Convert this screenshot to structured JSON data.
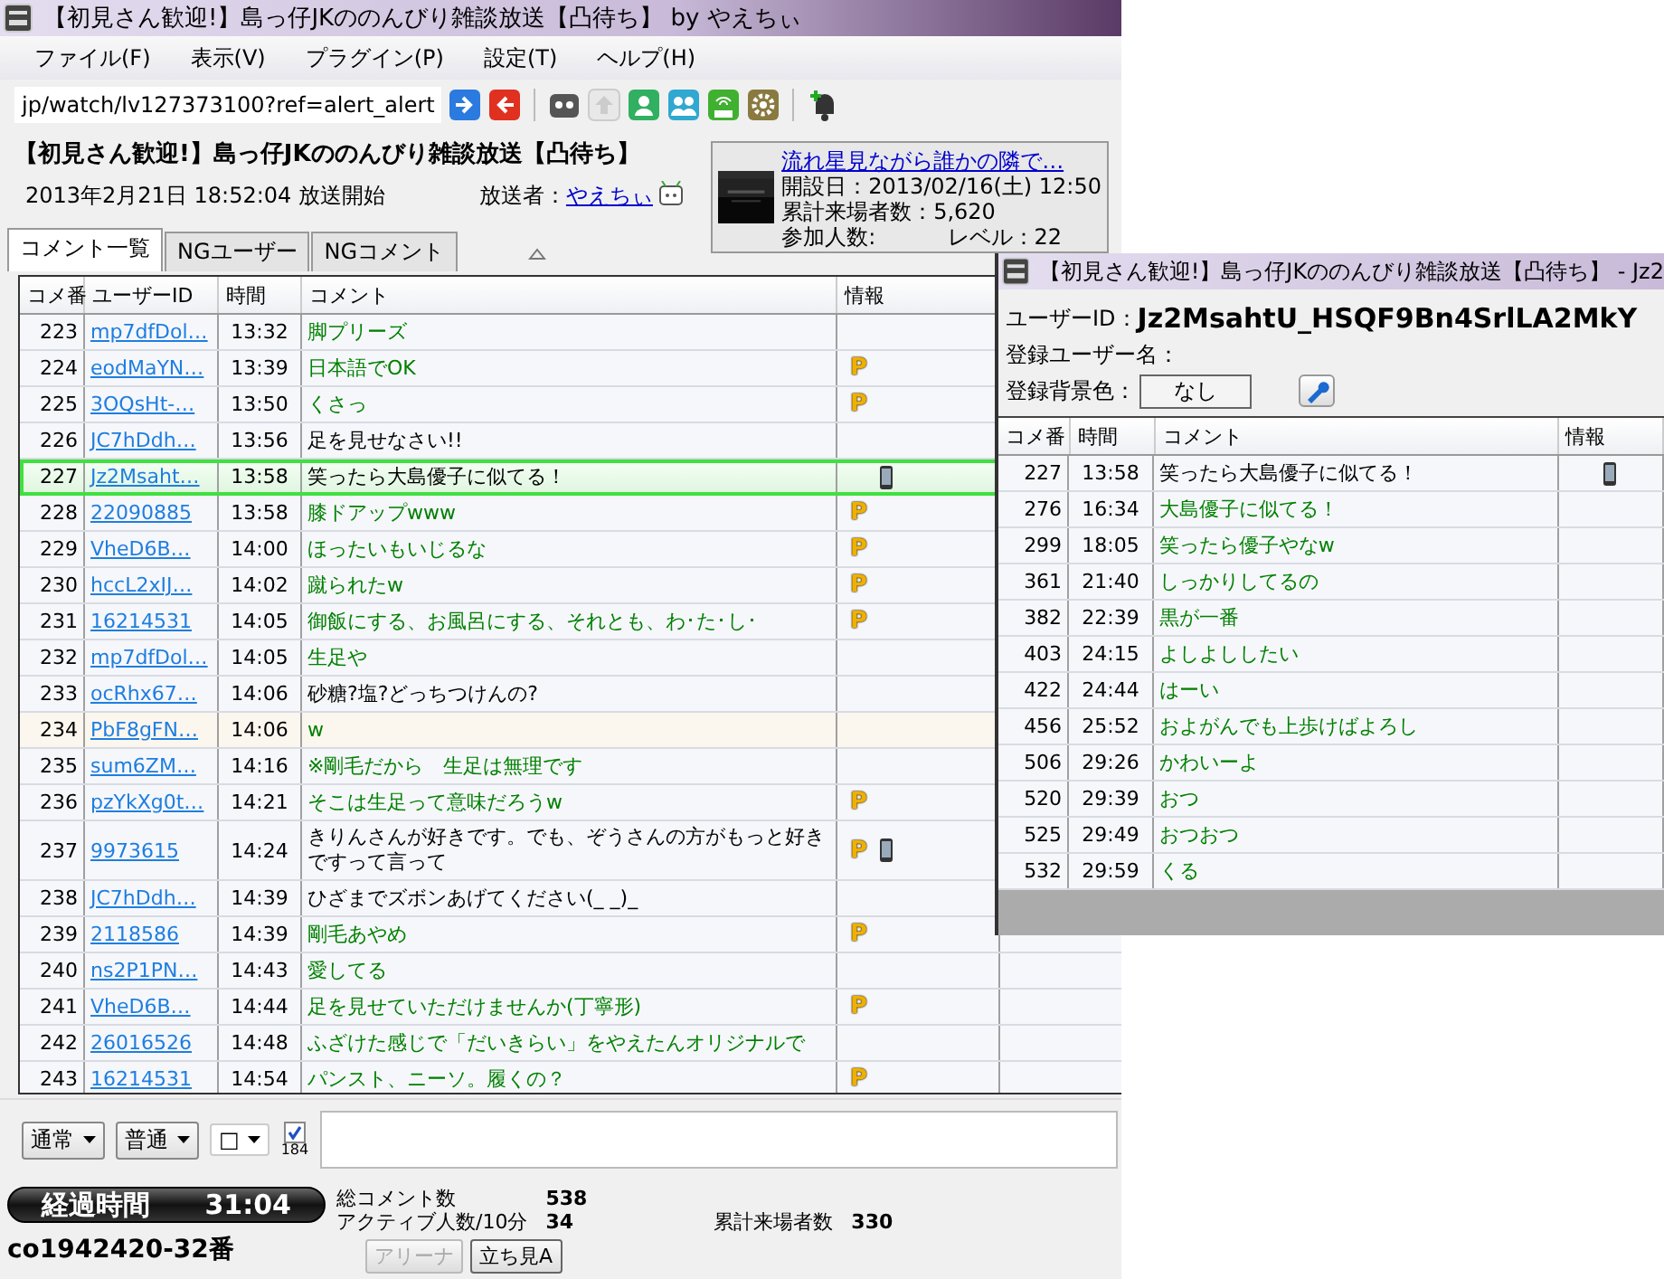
{
  "main_window": {
    "title": "【初見さん歓迎!】島っ仔JKののんびり雑談放送【凸待ち】 by やえちぃ",
    "menu": [
      "ファイル(F)",
      "表示(V)",
      "プラグイン(P)",
      "設定(T)",
      "ヘルプ(H)"
    ],
    "url": "jp/watch/lv127373100?ref=alert_alert",
    "stream_title": "【初見さん歓迎!】島っ仔JKののんびり雑談放送【凸待ち】",
    "start_time": "2013年2月21日  18:52:04 放送開始",
    "broadcaster_label": "放送者：",
    "broadcaster": "やえちぃ",
    "community": {
      "title": "流れ星見ながら誰かの隣で…",
      "opened": "開設日：2013/02/16(土) 12:50",
      "visitors": "累計来場者数：5,620",
      "participants": "参加人数:",
      "level_text": "レベル：22"
    },
    "tabs": [
      {
        "label": "コメント一覧",
        "selected": true
      },
      {
        "label": "NGユーザー",
        "selected": false
      },
      {
        "label": "NGコメント",
        "selected": false
      }
    ],
    "comments": {
      "columns": [
        "コメ番",
        "ユーザーID",
        "時間",
        "コメント",
        "情報"
      ],
      "rows": [
        {
          "no": "223",
          "user": "mp7dfDol…",
          "time": "13:32",
          "comment": "脚プリーズ",
          "color": "#008000",
          "badge": "",
          "mobile": false,
          "selected": false,
          "highlighted": false
        },
        {
          "no": "224",
          "user": "eodMaYN…",
          "time": "13:39",
          "comment": "日本語でOK",
          "color": "#008000",
          "badge": "P",
          "mobile": false,
          "selected": false,
          "highlighted": false
        },
        {
          "no": "225",
          "user": "3OQsHt-…",
          "time": "13:50",
          "comment": "くさっ",
          "color": "#008000",
          "badge": "P",
          "mobile": false,
          "selected": false,
          "highlighted": false
        },
        {
          "no": "226",
          "user": "JC7hDdh…",
          "time": "13:56",
          "comment": "足を見せなさい!!",
          "color": "#000000",
          "badge": "",
          "mobile": false,
          "selected": false,
          "highlighted": false
        },
        {
          "no": "227",
          "user": "Jz2Msaht…",
          "time": "13:58",
          "comment": "笑ったら大島優子に似てる！",
          "color": "#000000",
          "badge": "",
          "mobile": true,
          "selected": true,
          "highlighted": false
        },
        {
          "no": "228",
          "user": "22090885",
          "time": "13:58",
          "comment": "膝ドアップwww",
          "color": "#008000",
          "badge": "P",
          "mobile": false,
          "selected": false,
          "highlighted": false
        },
        {
          "no": "229",
          "user": "VheD6B…",
          "time": "14:00",
          "comment": "ほったいもいじるな",
          "color": "#008000",
          "badge": "P",
          "mobile": false,
          "selected": false,
          "highlighted": false
        },
        {
          "no": "230",
          "user": "hccL2xIJ…",
          "time": "14:02",
          "comment": "蹴られたw",
          "color": "#008000",
          "badge": "P",
          "mobile": false,
          "selected": false,
          "highlighted": false
        },
        {
          "no": "231",
          "user": "16214531",
          "time": "14:05",
          "comment": "御飯にする、お風呂にする、それとも、わ･た･し･",
          "color": "#008000",
          "badge": "P",
          "mobile": false,
          "selected": false,
          "highlighted": false
        },
        {
          "no": "232",
          "user": "mp7dfDol…",
          "time": "14:05",
          "comment": "生足や",
          "color": "#008000",
          "badge": "",
          "mobile": false,
          "selected": false,
          "highlighted": false
        },
        {
          "no": "233",
          "user": "ocRhx67…",
          "time": "14:06",
          "comment": "砂糖?塩?どっちつけんの?",
          "color": "#000000",
          "badge": "",
          "mobile": false,
          "selected": false,
          "highlighted": false
        },
        {
          "no": "234",
          "user": "PbF8gFN…",
          "time": "14:06",
          "comment": "w",
          "color": "#008000",
          "badge": "",
          "mobile": false,
          "selected": false,
          "highlighted": true
        },
        {
          "no": "235",
          "user": "sum6ZM…",
          "time": "14:16",
          "comment": "※剛毛だから　生足は無理です",
          "color": "#008000",
          "badge": "",
          "mobile": false,
          "selected": false,
          "highlighted": false
        },
        {
          "no": "236",
          "user": "pzYkXg0t…",
          "time": "14:21",
          "comment": "そこは生足って意味だろうw",
          "color": "#008000",
          "badge": "P",
          "mobile": false,
          "selected": false,
          "highlighted": false
        },
        {
          "no": "237",
          "user": "9973615",
          "time": "14:24",
          "comment": "きりんさんが好きです。でも、ぞうさんの方がもっと好きですって言って",
          "color": "#000000",
          "badge": "P",
          "mobile": true,
          "selected": false,
          "highlighted": false
        },
        {
          "no": "238",
          "user": "JC7hDdh…",
          "time": "14:39",
          "comment": "ひざまでズボンあげてください(_ _)_",
          "color": "#000000",
          "badge": "",
          "mobile": false,
          "selected": false,
          "highlighted": false
        },
        {
          "no": "239",
          "user": "2118586",
          "time": "14:39",
          "comment": "剛毛あやめ",
          "color": "#008000",
          "badge": "P",
          "mobile": false,
          "selected": false,
          "highlighted": false
        },
        {
          "no": "240",
          "user": "ns2P1PN…",
          "time": "14:43",
          "comment": "愛してる",
          "color": "#008000",
          "badge": "",
          "mobile": false,
          "selected": false,
          "highlighted": false
        },
        {
          "no": "241",
          "user": "VheD6B…",
          "time": "14:44",
          "comment": "足を見せていただけませんか(丁寧形)",
          "color": "#008000",
          "badge": "P",
          "mobile": false,
          "selected": false,
          "highlighted": false
        },
        {
          "no": "242",
          "user": "26016526",
          "time": "14:48",
          "comment": "ふざけた感じで「だいきらい」をやえたんオリジナルで",
          "color": "#008000",
          "badge": "",
          "mobile": false,
          "selected": false,
          "highlighted": false
        },
        {
          "no": "243",
          "user": "16214531",
          "time": "14:54",
          "comment": "パンスト、ニーソ。履くの？",
          "color": "#008000",
          "badge": "P",
          "mobile": false,
          "selected": false,
          "highlighted": false
        }
      ]
    },
    "post_bar": {
      "command": "通常",
      "size": "普通",
      "color_box": "□",
      "anonymous": {
        "label": "184",
        "checked": true
      }
    },
    "stats": {
      "elapsed_label": "経過時間",
      "elapsed": "31:04",
      "total_label": "総コメント数",
      "total": "538",
      "active_label": "アクティブ人数/10分",
      "active": "34",
      "visitors_label": "累計来場者数",
      "visitors": "330"
    },
    "room": "co1942420-32番",
    "seat_buttons": [
      {
        "label": "アリーナ",
        "disabled": true
      },
      {
        "label": "立ち見A",
        "disabled": false
      }
    ]
  },
  "user_window": {
    "title": "【初見さん歓迎!】島っ仔JKののんびり雑談放送【凸待ち】 - Jz2",
    "user_id_label": "ユーザーID：",
    "user_id": "Jz2MsahtU_HSQF9Bn4SrlLA2MkY",
    "name_label": "登録ユーザー名：",
    "bg_label": "登録背景色：",
    "bg_value": "なし",
    "columns": [
      "コメ番",
      "時間",
      "コメント",
      "情報"
    ],
    "rows": [
      {
        "no": "227",
        "time": "13:58",
        "comment": "笑ったら大島優子に似てる！",
        "color": "#000000",
        "mobile": true
      },
      {
        "no": "276",
        "time": "16:34",
        "comment": "大島優子に似てる！",
        "color": "#008000",
        "mobile": false
      },
      {
        "no": "299",
        "time": "18:05",
        "comment": "笑ったら優子やなw",
        "color": "#008000",
        "mobile": false
      },
      {
        "no": "361",
        "time": "21:40",
        "comment": "しっかりしてるの",
        "color": "#008000",
        "mobile": false
      },
      {
        "no": "382",
        "time": "22:39",
        "comment": "黒が一番",
        "color": "#008000",
        "mobile": false
      },
      {
        "no": "403",
        "time": "24:15",
        "comment": "よしよししたい",
        "color": "#008000",
        "mobile": false
      },
      {
        "no": "422",
        "time": "24:44",
        "comment": "はーい",
        "color": "#008000",
        "mobile": false
      },
      {
        "no": "456",
        "time": "25:52",
        "comment": "およがんでも上歩けばよろし",
        "color": "#008000",
        "mobile": false
      },
      {
        "no": "506",
        "time": "29:26",
        "comment": "かわいーよ",
        "color": "#008000",
        "mobile": false
      },
      {
        "no": "520",
        "time": "29:39",
        "comment": "おつ",
        "color": "#008000",
        "mobile": false
      },
      {
        "no": "525",
        "time": "29:49",
        "comment": "おつおつ",
        "color": "#008000",
        "mobile": false
      },
      {
        "no": "532",
        "time": "29:59",
        "comment": "くる",
        "color": "#008000",
        "mobile": false
      }
    ]
  }
}
